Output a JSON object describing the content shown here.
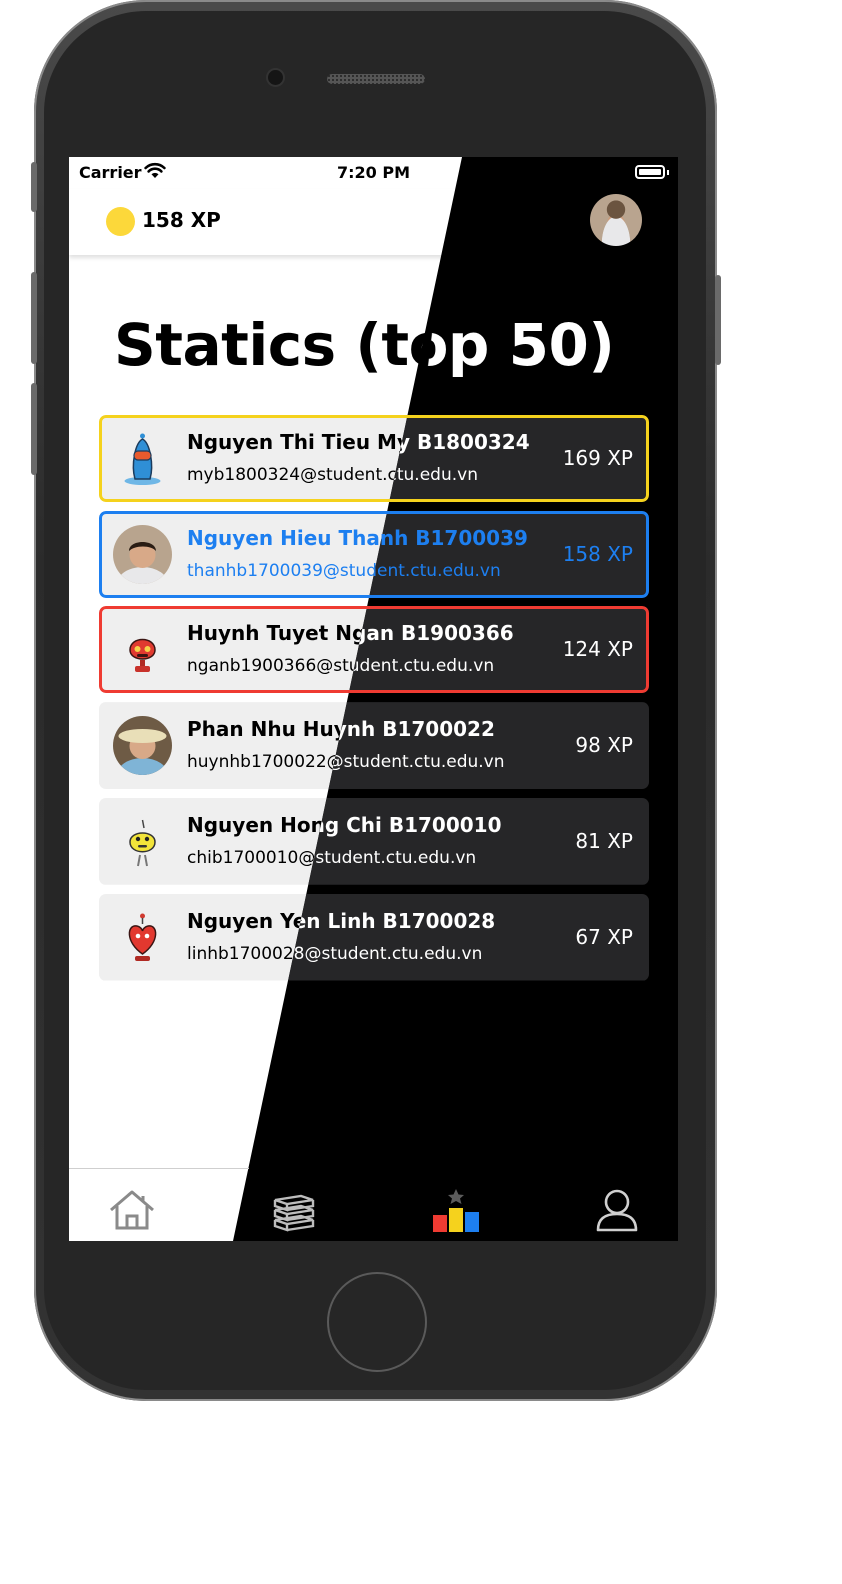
{
  "status_bar": {
    "carrier": "Carrier",
    "time": "7:20 PM"
  },
  "header": {
    "xp_total": "158 XP"
  },
  "page": {
    "title": "Statics (top 50)"
  },
  "leaderboard": [
    {
      "name": "Nguyen Thi Tieu My B1800324",
      "email": "myb1800324@student.ctu.edu.vn",
      "xp": "169 XP",
      "highlight": "#f5d21d",
      "avatar": "blue-robot-avatar"
    },
    {
      "name": "Nguyen Hieu Thanh B1700039",
      "email": "thanhb1700039@student.ctu.edu.vn",
      "xp": "158 XP",
      "highlight": "#1d7ff0",
      "avatar": "photo-avatar"
    },
    {
      "name": "Huynh Tuyet Ngan B1900366",
      "email": "nganb1900366@student.ctu.edu.vn",
      "xp": "124 XP",
      "highlight": "#ef3b32",
      "avatar": "red-robot-avatar"
    },
    {
      "name": "Phan Nhu Huynh B1700022",
      "email": "huynhb1700022@student.ctu.edu.vn",
      "xp": "98 XP",
      "highlight": null,
      "avatar": "photo-avatar"
    },
    {
      "name": "Nguyen Hong Chi B1700010",
      "email": "chib1700010@student.ctu.edu.vn",
      "xp": "81 XP",
      "highlight": null,
      "avatar": "yellow-robot-avatar"
    },
    {
      "name": "Nguyen Yen Linh B1700028",
      "email": "linhb1700028@student.ctu.edu.vn",
      "xp": "67 XP",
      "highlight": null,
      "avatar": "red-heart-robot-avatar"
    }
  ],
  "tabs": [
    {
      "icon": "home-icon",
      "active": false
    },
    {
      "icon": "books-icon",
      "active": false
    },
    {
      "icon": "leaderboard-icon",
      "active": true
    },
    {
      "icon": "user-icon",
      "active": false
    }
  ],
  "colors": {
    "gold": "#f5d21d",
    "blue": "#1d7ff0",
    "red": "#ef3b32",
    "coin": "#fcd83a"
  }
}
